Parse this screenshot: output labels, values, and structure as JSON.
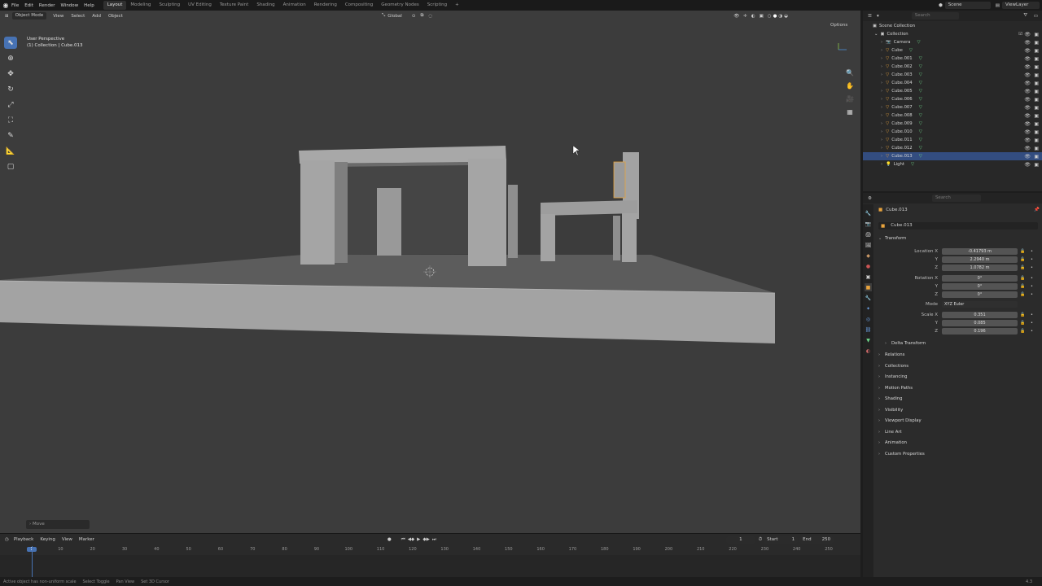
{
  "topbar": {
    "menus": [
      "File",
      "Edit",
      "Render",
      "Window",
      "Help"
    ],
    "workspaces": [
      "Layout",
      "Modeling",
      "Sculpting",
      "UV Editing",
      "Texture Paint",
      "Shading",
      "Animation",
      "Rendering",
      "Compositing",
      "Geometry Nodes",
      "Scripting"
    ],
    "active_workspace": "Layout",
    "add_tab": "+",
    "scene": "Scene",
    "view_layer": "ViewLayer"
  },
  "viewport": {
    "mode": "Object Mode",
    "menus": [
      "View",
      "Select",
      "Add",
      "Object"
    ],
    "orientation": "Global",
    "options": "Options",
    "info_line1": "User Perspective",
    "info_line2": "(1) Collection | Cube.013",
    "operator_panel": "Move"
  },
  "timeline": {
    "menus": [
      "Playback",
      "Keying",
      "View",
      "Marker"
    ],
    "current_frame": "1",
    "start_label": "Start",
    "start": "1",
    "end_label": "End",
    "end": "250",
    "ruler": [
      "1",
      "10",
      "20",
      "30",
      "40",
      "50",
      "60",
      "70",
      "80",
      "90",
      "100",
      "110",
      "120",
      "130",
      "140",
      "150",
      "160",
      "170",
      "180",
      "190",
      "200",
      "210",
      "220",
      "230",
      "240",
      "250"
    ]
  },
  "statusbar": {
    "items": [
      "Active object has non-uniform scale",
      "Select Toggle",
      "Pan View",
      "Set 3D Cursor"
    ],
    "version": "4.3"
  },
  "outliner": {
    "search_placeholder": "Search",
    "root": "Scene Collection",
    "collection": "Collection",
    "objects": [
      "Camera",
      "Cube",
      "Cube.001",
      "Cube.002",
      "Cube.003",
      "Cube.004",
      "Cube.005",
      "Cube.006",
      "Cube.007",
      "Cube.008",
      "Cube.009",
      "Cube.010",
      "Cube.011",
      "Cube.012",
      "Cube.013",
      "Light"
    ],
    "selected": "Cube.013"
  },
  "properties": {
    "search_placeholder": "Search",
    "object_name": "Cube.013",
    "object_field": "Cube.013",
    "transform_label": "Transform",
    "location_label": "Location X",
    "rotation_label": "Rotation X",
    "mode_label": "Mode",
    "scale_label": "Scale X",
    "axis_y": "Y",
    "axis_z": "Z",
    "location": [
      "-0.41793 m",
      "2.2940 m",
      "1.0782 m"
    ],
    "rotation": [
      "0°",
      "0°",
      "0°"
    ],
    "mode": "XYZ Euler",
    "scale": [
      "0.351",
      "0.085",
      "0.196"
    ],
    "delta_transform": "Delta Transform",
    "panels": [
      "Relations",
      "Collections",
      "Instancing",
      "Motion Paths",
      "Shading",
      "Visibility",
      "Viewport Display",
      "Line Art",
      "Animation",
      "Custom Properties"
    ]
  },
  "colors": {
    "accent": "#4772b3",
    "selection": "#334d80",
    "viewport_bg": "#3c3c3c",
    "object_orange": "#e8a33d"
  }
}
